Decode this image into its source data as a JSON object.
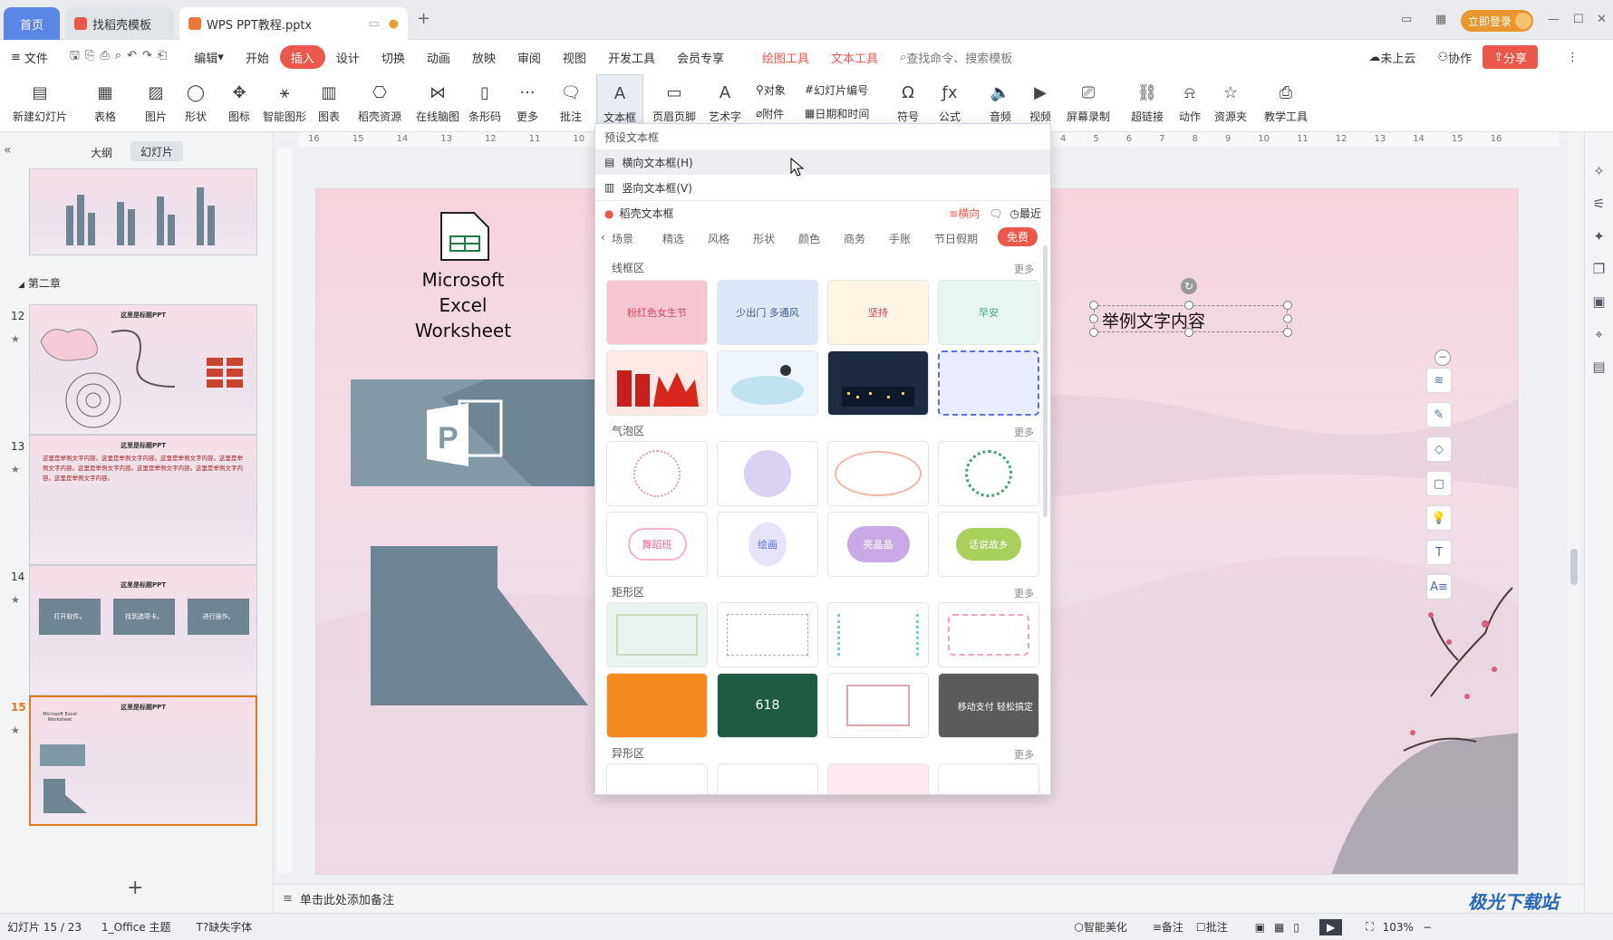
{
  "titlebar": {
    "tab_home": "首页",
    "tab_templates": "找稻壳模板",
    "tab_doc": "WPS PPT教程.pptx",
    "add_tab": "+",
    "login": "立即登录"
  },
  "menu": {
    "file": "文件",
    "edit": "编辑",
    "items": [
      "开始",
      "插入",
      "设计",
      "切换",
      "动画",
      "放映",
      "审阅",
      "视图",
      "开发工具",
      "会员专享"
    ],
    "drawing_tools": "绘图工具",
    "text_tools": "文本工具",
    "search": "查找命令、搜索模板",
    "cloud": "未上云",
    "collab": "协作",
    "share": "分享"
  },
  "ribbon": {
    "new_slide": "新建幻灯片",
    "table": "表格",
    "picture": "图片",
    "shape": "形状",
    "icon": "图标",
    "smart": "智能图形",
    "chart": "图表",
    "docer": "稻壳资源",
    "mindmap": "在线脑图",
    "barcode": "条形码",
    "more": "更多",
    "comment": "批注",
    "textbox": "文本框",
    "header_footer": "页眉页脚",
    "wordart": "艺术字",
    "object": "对象",
    "attachment": "附件",
    "slide_num": "幻灯片编号",
    "datetime": "日期和时间",
    "symbol": "符号",
    "formula": "公式",
    "audio": "音频",
    "video": "视频",
    "screen_rec": "屏幕录制",
    "hyperlink": "超链接",
    "action": "动作",
    "resource": "资源夹",
    "teaching": "教学工具"
  },
  "panel": {
    "outline": "大纲",
    "slides": "幻灯片",
    "chapter": "第二章",
    "slide_nums": [
      "12",
      "13",
      "14",
      "15"
    ],
    "t12_title": "这里是标题PPT",
    "t13_title": "这里是标题PPT",
    "t13_body": "这里是举例文字内容。这里是举例文字内容。这里是举例文字内容。这里是举例文字内容。这里是举例文字内容。这里是举例文字内容。这里是举例文字内容。这里是举例文字内容。",
    "t14_title": "这里是标题PPT",
    "t14_b1": "打开软件。",
    "t14_b2": "找到选项卡。",
    "t14_b3": "进行操作。",
    "t15_title": "这里是标题PPT",
    "t15_excel": "Microsoft Excel Worksheet",
    "star": "★",
    "add": "+"
  },
  "ruler": {
    "left": [
      "16",
      "15",
      "14",
      "13",
      "12",
      "11",
      "10"
    ],
    "right": [
      "4",
      "5",
      "6",
      "7",
      "8",
      "9",
      "10",
      "11",
      "12",
      "13",
      "14",
      "15",
      "16"
    ]
  },
  "slide": {
    "excel_label_1": "Microsoft Excel",
    "excel_label_2": "Worksheet",
    "sample_text": "举例文字内容"
  },
  "dropdown": {
    "preset": "预设文本框",
    "horizontal": "横向文本框(H)",
    "vertical": "竖向文本框(V)",
    "docer": "稻壳文本框",
    "horizontal_toggle": "横向",
    "recent": "最近",
    "cats": [
      "场景",
      "精选",
      "风格",
      "形状",
      "颜色",
      "商务",
      "手账",
      "节日假期",
      "免费"
    ],
    "sec_line": "线框区",
    "sec_bubble": "气泡区",
    "sec_rect": "矩形区",
    "sec_special": "异形区",
    "more": "更多",
    "cards": [
      "粉红色女生节",
      "少出门 多通风",
      "坚持",
      "早安",
      "",
      "",
      "",
      "",
      "",
      "",
      "",
      "",
      "",
      "舞蹈班",
      "绘画",
      "亮晶晶",
      "话说故乡",
      "",
      "",
      "",
      "",
      "",
      "618",
      "",
      "移动支付 轻松搞定",
      "",
      "",
      "",
      ""
    ]
  },
  "notes": "单击此处添加备注",
  "status": {
    "slide": "幻灯片 15 / 23",
    "theme": "1_Office 主题",
    "font": "缺失字体",
    "beautify": "智能美化",
    "notes": "备注",
    "comment": "批注",
    "zoom": "103%"
  },
  "watermark": "极光下载站"
}
